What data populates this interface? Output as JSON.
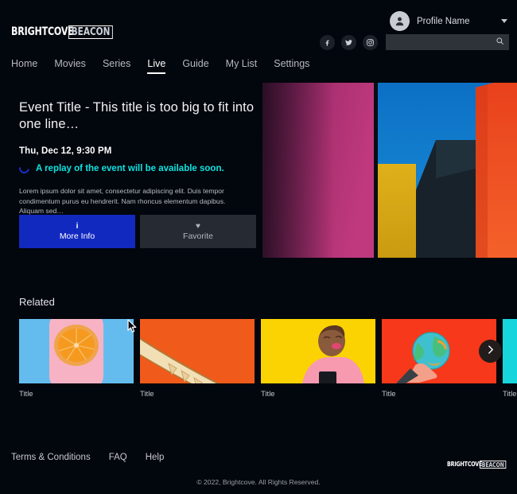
{
  "brand": {
    "logo_word": "BRIGHTCOVE",
    "logo_box": "BEACON"
  },
  "header": {
    "profile": {
      "name": "Profile Name",
      "avatar_icon": "user-avatar-icon",
      "chevron_icon": "chevron-down-icon"
    },
    "social": [
      {
        "name": "facebook-icon",
        "glyph": "f"
      },
      {
        "name": "twitter-icon",
        "glyph": "t"
      },
      {
        "name": "instagram-icon",
        "glyph": "i"
      }
    ],
    "search": {
      "value": "",
      "placeholder": "",
      "icon": "search-icon"
    }
  },
  "nav": {
    "items": [
      {
        "label": "Home",
        "active": false
      },
      {
        "label": "Movies",
        "active": false
      },
      {
        "label": "Series",
        "active": false
      },
      {
        "label": "Live",
        "active": true
      },
      {
        "label": "Guide",
        "active": false
      },
      {
        "label": "My List",
        "active": false
      },
      {
        "label": "Settings",
        "active": false
      }
    ]
  },
  "hero": {
    "title": "Event Title - This title is too big to fit into one line…",
    "date": "Thu, Dec 12, 9:30 PM",
    "status_message": "A replay of the event will be available soon.",
    "status_icon": "loading-spinner-icon",
    "status_color": "#0fe3df",
    "description": "Lorem ipsum dolor sit amet, consectetur adipiscing elit. Duis tempor condimentum purus eu hendrerit. Nam rhoncus elementum dapibus. Aliquam sed…",
    "buttons": [
      {
        "label": "More Info",
        "icon": "info-icon",
        "glyph": "i",
        "style": "primary",
        "color": "#1229c0"
      },
      {
        "label": "Favorite",
        "icon": "heart-icon",
        "glyph": "♥",
        "style": "secondary",
        "color": "#262a33"
      }
    ]
  },
  "related": {
    "heading": "Related",
    "next_icon": "chevron-right-icon",
    "cards": [
      {
        "label": "Title",
        "thumb": "orange-slice-on-pink"
      },
      {
        "label": "Title",
        "thumb": "cream-arc-on-orange"
      },
      {
        "label": "Title",
        "thumb": "woman-pink-shirt-on-yellow"
      },
      {
        "label": "Title",
        "thumb": "globe-in-hand-on-red"
      },
      {
        "label": "Title",
        "thumb": "cyan-partial"
      }
    ]
  },
  "footer": {
    "links": [
      {
        "label": "Terms & Conditions"
      },
      {
        "label": "FAQ"
      },
      {
        "label": "Help"
      }
    ],
    "copyright": "© 2022, Brightcove. All Rights Reserved."
  },
  "theme": {
    "background": "#02060d",
    "accent_blue": "#1229c0",
    "accent_cyan": "#0fe3df",
    "search_bg": "#2e3239"
  }
}
